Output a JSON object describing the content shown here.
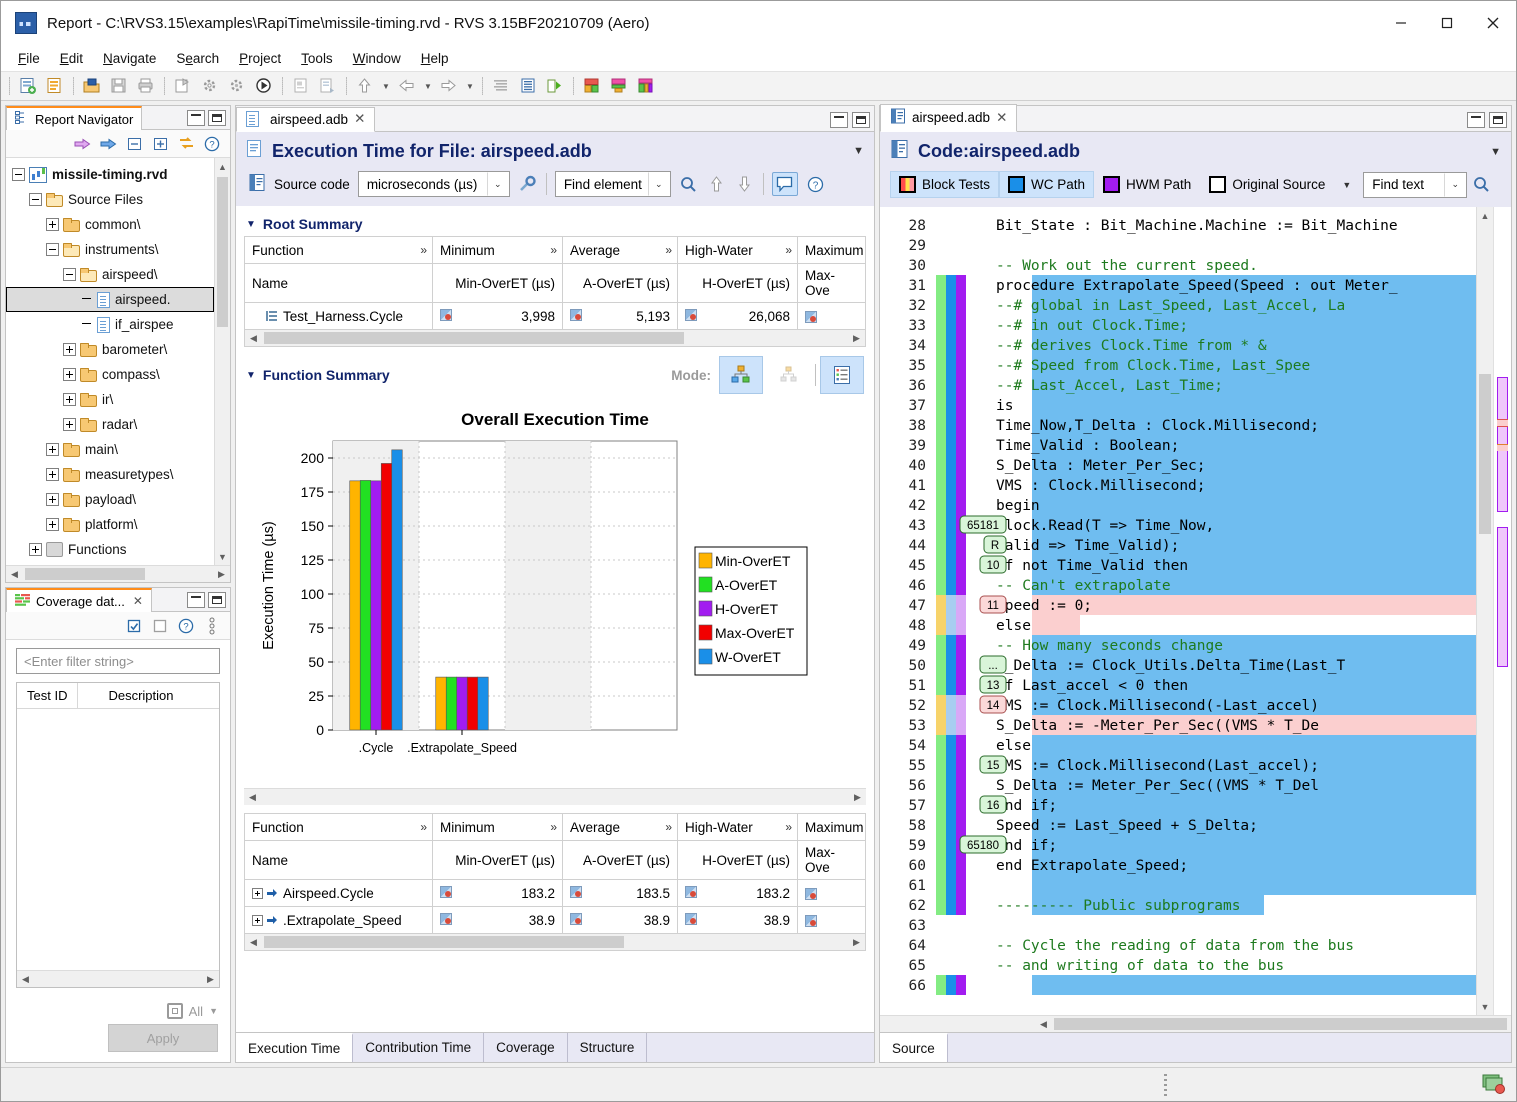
{
  "window": {
    "title": "Report - C:\\RVS3.15\\examples\\RapiTime\\missile-timing.rvd - RVS 3.15BF20210709 (Aero)",
    "minimize_label": "Minimize",
    "maximize_label": "Maximize",
    "close_label": "Close"
  },
  "menu": [
    {
      "label": "File",
      "mnemonic": "F"
    },
    {
      "label": "Edit",
      "mnemonic": "E"
    },
    {
      "label": "Navigate",
      "mnemonic": "N"
    },
    {
      "label": "Search",
      "mnemonic": "S"
    },
    {
      "label": "Project",
      "mnemonic": "P"
    },
    {
      "label": "Tools",
      "mnemonic": "T"
    },
    {
      "label": "Window",
      "mnemonic": "W"
    },
    {
      "label": "Help",
      "mnemonic": "H"
    }
  ],
  "toolbar": {
    "items": [
      "new-report-icon",
      "open-report-icon",
      "open-folder-icon",
      "save-icon",
      "print-icon",
      "new-project-icon",
      "build-icon",
      "debug-icon",
      "run-icon",
      "report-view-icon",
      "export-report-icon",
      "navigate-up-icon",
      "navigate-back-icon",
      "navigate-forward-icon",
      "list-view-icon",
      "table-view-icon",
      "run-analysis-icon",
      "coverage-perspective-icon",
      "timing-perspective-icon",
      "structure-perspective-icon"
    ]
  },
  "navigator": {
    "tab_label": "Report Navigator",
    "tab_icon": "report-navigator-icon",
    "tools": [
      "forward-pink-icon",
      "forward-blue-icon",
      "collapse-all-icon",
      "expand-all-icon",
      "link-editor-icon",
      "help-icon"
    ],
    "tree": [
      {
        "label": "missile-timing.rvd",
        "depth": 0,
        "icon": "rvd-file-icon",
        "state": "minus",
        "bold": true
      },
      {
        "label": "Source Files",
        "depth": 1,
        "icon": "folder-open-icon",
        "state": "minus"
      },
      {
        "label": "common\\",
        "depth": 2,
        "icon": "folder-icon",
        "state": "plus"
      },
      {
        "label": "instruments\\",
        "depth": 2,
        "icon": "folder-open-icon",
        "state": "minus"
      },
      {
        "label": "airspeed\\",
        "depth": 3,
        "icon": "folder-open-icon",
        "state": "minus"
      },
      {
        "label": "airspeed.",
        "depth": 4,
        "icon": "source-file-icon",
        "state": "none",
        "selected": true
      },
      {
        "label": "if_airspee",
        "depth": 4,
        "icon": "source-file-icon",
        "state": "none"
      },
      {
        "label": "barometer\\",
        "depth": 3,
        "icon": "folder-icon",
        "state": "plus"
      },
      {
        "label": "compass\\",
        "depth": 3,
        "icon": "folder-icon",
        "state": "plus"
      },
      {
        "label": "ir\\",
        "depth": 3,
        "icon": "folder-icon",
        "state": "plus"
      },
      {
        "label": "radar\\",
        "depth": 3,
        "icon": "folder-icon",
        "state": "plus"
      },
      {
        "label": "main\\",
        "depth": 2,
        "icon": "folder-icon",
        "state": "plus"
      },
      {
        "label": "measuretypes\\",
        "depth": 2,
        "icon": "folder-icon",
        "state": "plus"
      },
      {
        "label": "payload\\",
        "depth": 2,
        "icon": "folder-icon",
        "state": "plus"
      },
      {
        "label": "platform\\",
        "depth": 2,
        "icon": "folder-icon",
        "state": "plus"
      },
      {
        "label": "Functions",
        "depth": 1,
        "icon": "functions-icon",
        "state": "plus"
      }
    ]
  },
  "coverage": {
    "tab_label": "Coverage dat...",
    "tab_icon": "coverage-data-icon",
    "tools": [
      "checked-box-icon",
      "unchecked-box-icon",
      "help-icon",
      "view-menu-icon"
    ],
    "filter_placeholder": "<Enter filter string>",
    "columns": [
      "Test ID",
      "Description"
    ],
    "rows": [],
    "all_label": "All",
    "apply_label": "Apply"
  },
  "editor": {
    "tab_label": "airspeed.adb",
    "tab_icon": "source-file-icon",
    "tab_close": "close-icon",
    "title": "Execution Time for File: airspeed.adb",
    "title_icon": "document-icon",
    "menu_caret": "view-menu-caret",
    "source_code_label": "Source code",
    "source_code_icon": "source-code-icon",
    "units_value": "microseconds (µs)",
    "wrench_icon": "preferences-icon",
    "find_element_placeholder": "Find element",
    "find_icon": "search-icon",
    "up_icon": "find-previous-icon",
    "down_icon": "find-next-icon",
    "annotate_icon": "annotations-toggle",
    "help_icon": "help-icon",
    "root_summary": {
      "title": "Root Summary",
      "header_row1": [
        "Function",
        "Minimum",
        "Average",
        "High-Water",
        "Maximum"
      ],
      "header_row2": [
        "Name",
        "Min-OverET (µs)",
        "A-OverET (µs)",
        "H-OverET (µs)",
        "Max-Ove"
      ],
      "rows": [
        {
          "name": "Test_Harness.Cycle",
          "min": "3,998",
          "avg": "5,193",
          "hwm": "26,068",
          "max": ""
        }
      ]
    },
    "function_summary": {
      "title": "Function Summary",
      "mode_label": "Mode:",
      "mode_buttons": [
        "hierarchy-mode-icon",
        "flat-mode-icon",
        "list-mode-icon"
      ],
      "header_row1": [
        "Function",
        "Minimum",
        "Average",
        "High-Water",
        "Maximum"
      ],
      "header_row2": [
        "Name",
        "Min-OverET (µs)",
        "A-OverET (µs)",
        "H-OverET (µs)",
        "Max-Ove"
      ],
      "rows": [
        {
          "name": "Airspeed.Cycle",
          "min": "183.2",
          "avg": "183.5",
          "hwm": "183.2",
          "max": ""
        },
        {
          "name": ".Extrapolate_Speed",
          "min": "38.9",
          "avg": "38.9",
          "hwm": "38.9",
          "max": ""
        }
      ]
    },
    "bottom_tabs": [
      {
        "label": "Execution Time",
        "active": true
      },
      {
        "label": "Contribution Time",
        "active": false
      },
      {
        "label": "Coverage",
        "active": false
      },
      {
        "label": "Structure",
        "active": false
      }
    ]
  },
  "chart_data": {
    "type": "bar",
    "title": "Overall Execution Time",
    "xlabel": "",
    "ylabel": "Execution Time (µs)",
    "categories": [
      ".Cycle",
      ".Extrapolate_Speed"
    ],
    "ylim": [
      0,
      212.5
    ],
    "yticks": [
      0,
      25,
      50,
      75,
      100,
      125,
      150,
      175,
      200
    ],
    "grid": true,
    "legend_position": "right",
    "series": [
      {
        "name": "Min-OverET",
        "color": "#ffb400",
        "values": [
          183.2,
          38.9
        ]
      },
      {
        "name": "A-OverET",
        "color": "#22e022",
        "values": [
          183.5,
          38.9
        ]
      },
      {
        "name": "H-OverET",
        "color": "#a21cf0",
        "values": [
          183.2,
          38.9
        ]
      },
      {
        "name": "Max-OverET",
        "color": "#f20000",
        "values": [
          196.0,
          38.9
        ]
      },
      {
        "name": "W-OverET",
        "color": "#1a8fe8",
        "values": [
          206.0,
          38.9
        ]
      }
    ]
  },
  "code": {
    "tab_label": "airspeed.adb",
    "tab_icon": "source-code-icon",
    "tab_close": "close-icon",
    "title": "Code:airspeed.adb",
    "title_icon": "source-code-icon",
    "menu_caret": "view-menu-caret",
    "toggles": [
      {
        "label": "Block Tests",
        "swatch": "blocks",
        "on": true
      },
      {
        "label": "WC Path",
        "swatch": "wc",
        "on": true
      },
      {
        "label": "HWM Path",
        "swatch": "hwm",
        "on": false
      },
      {
        "label": "Original Source",
        "swatch": "orig",
        "on": false
      }
    ],
    "toggle_caret": "dropdown-caret",
    "find_text_placeholder": "Find text",
    "find_icon": "search-icon",
    "source_tab_label": "Source",
    "first_line": 28,
    "lines": [
      {
        "n": 28,
        "text": "        Bit_State : Bit_Machine.Machine := Bit_Machine"
      },
      {
        "n": 29,
        "text": ""
      },
      {
        "n": 30,
        "text": "        -- Work out the current speed.",
        "comment": true
      },
      {
        "n": 31,
        "text": "        procedure Extrapolate_Speed(Speed : out Meter_"
      },
      {
        "n": 32,
        "text": "          --# global in    Last_Speed, Last_Accel, La",
        "comment": true
      },
      {
        "n": 33,
        "text": "          --#          in out Clock.Time;",
        "comment": true
      },
      {
        "n": 34,
        "text": "          --# derives Clock.Time from * &",
        "comment": true
      },
      {
        "n": 35,
        "text": "          --#              Speed from Clock.Time, Last_Spee",
        "comment": true
      },
      {
        "n": 36,
        "text": "          --#              Last_Accel, Last_Time;",
        "comment": true
      },
      {
        "n": 37,
        "text": "        is"
      },
      {
        "n": 38,
        "text": "          Time_Now,T_Delta : Clock.Millisecond;"
      },
      {
        "n": 39,
        "text": "          Time_Valid : Boolean;"
      },
      {
        "n": 40,
        "text": "          S_Delta : Meter_Per_Sec;"
      },
      {
        "n": 41,
        "text": "          VMS : Clock.Millisecond;"
      },
      {
        "n": 42,
        "text": "        begin"
      },
      {
        "n": 43,
        "text": "           Clock.Read(T => Time_Now,"
      },
      {
        "n": 44,
        "text": "                      Valid => Time_Valid);"
      },
      {
        "n": 45,
        "text": "          if not Time_Valid then"
      },
      {
        "n": 46,
        "text": "            -- Can't extrapolate",
        "comment": true
      },
      {
        "n": 47,
        "text": "            Speed := 0;"
      },
      {
        "n": 48,
        "text": "          else"
      },
      {
        "n": 49,
        "text": "             -- How many seconds change",
        "comment": true
      },
      {
        "n": 50,
        "text": "             T_Delta := Clock_Utils.Delta_Time(Last_T"
      },
      {
        "n": 51,
        "text": "             if Last_accel < 0 then"
      },
      {
        "n": 52,
        "text": "               VMS := Clock.Millisecond(-Last_accel)"
      },
      {
        "n": 53,
        "text": "               S_Delta := -Meter_Per_Sec((VMS * T_De"
      },
      {
        "n": 54,
        "text": "             else"
      },
      {
        "n": 55,
        "text": "               VMS := Clock.Millisecond(Last_accel);"
      },
      {
        "n": 56,
        "text": "               S_Delta := Meter_Per_Sec((VMS * T_Del"
      },
      {
        "n": 57,
        "text": "             end if;"
      },
      {
        "n": 58,
        "text": "             Speed := Last_Speed + S_Delta;"
      },
      {
        "n": 59,
        "text": "          end if;"
      },
      {
        "n": 60,
        "text": "        end Extrapolate_Speed;"
      },
      {
        "n": 61,
        "text": ""
      },
      {
        "n": 62,
        "text": "        --------- Public subprograms",
        "comment": true
      },
      {
        "n": 63,
        "text": ""
      },
      {
        "n": 64,
        "text": "        -- Cycle the reading of data from the bus",
        "comment": true
      },
      {
        "n": 65,
        "text": "        -- and writing of data to the bus",
        "comment": true
      },
      {
        "n": 66,
        "text": ""
      }
    ],
    "badges": [
      {
        "line": 43,
        "text": "65181",
        "kind": "green"
      },
      {
        "line": 44,
        "text": "R",
        "kind": "green"
      },
      {
        "line": 45,
        "text": "10",
        "kind": "green"
      },
      {
        "line": 47,
        "text": "11",
        "kind": "pink"
      },
      {
        "line": 50,
        "text": "...",
        "kind": "green"
      },
      {
        "line": 51,
        "text": "13",
        "kind": "green"
      },
      {
        "line": 52,
        "text": "14",
        "kind": "pink"
      },
      {
        "line": 55,
        "text": "15",
        "kind": "green"
      },
      {
        "line": 57,
        "text": "16",
        "kind": "green"
      },
      {
        "line": 59,
        "text": "65180",
        "kind": "green"
      }
    ]
  },
  "colors": {
    "wc_path_highlight": "#6fbdf0",
    "uncovered_pink": "#fbcfcf",
    "gutter_green": "#83ec83",
    "gutter_yellow": "#f7d36a",
    "gutter_blue": "#1a8fe8",
    "gutter_lightblue": "#a8cdf0",
    "gutter_purple": "#a21cf0",
    "gutter_lightpurple": "#d9a8f7",
    "accent_title": "#11246b",
    "tab_accent": "#ff8c1a"
  },
  "statusbar": {
    "resize_grip": "resize-grip",
    "tray_icon": "rvs-tray-icon"
  }
}
